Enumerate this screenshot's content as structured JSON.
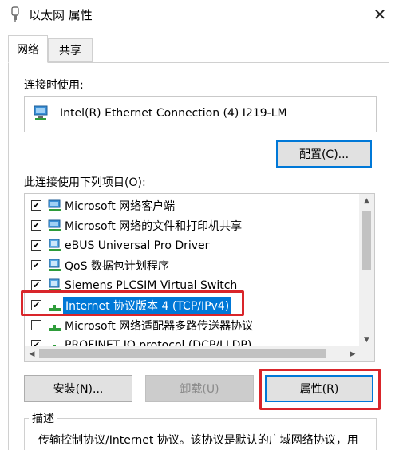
{
  "window": {
    "title": "以太网 属性",
    "close_glyph": "✕"
  },
  "tabs": [
    {
      "label": "网络",
      "active": true
    },
    {
      "label": "共享",
      "active": false
    }
  ],
  "connect_using_label": "连接时使用:",
  "adapter_name": "Intel(R) Ethernet Connection (4) I219-LM",
  "configure_button": "配置(C)...",
  "items_label": "此连接使用下列项目(O):",
  "items": [
    {
      "label": "Microsoft 网络客户端",
      "checked": true,
      "selected": false,
      "icon": "network-client-icon"
    },
    {
      "label": "Microsoft 网络的文件和打印机共享",
      "checked": true,
      "selected": false,
      "icon": "file-printer-sharing-icon"
    },
    {
      "label": "eBUS Universal Pro Driver",
      "checked": true,
      "selected": false,
      "icon": "service-icon"
    },
    {
      "label": "QoS 数据包计划程序",
      "checked": true,
      "selected": false,
      "icon": "service-icon"
    },
    {
      "label": "Siemens PLCSIM Virtual Switch",
      "checked": true,
      "selected": false,
      "icon": "service-icon"
    },
    {
      "label": "Internet 协议版本 4 (TCP/IPv4)",
      "checked": true,
      "selected": true,
      "icon": "protocol-icon"
    },
    {
      "label": "Microsoft 网络适配器多路传送器协议",
      "checked": false,
      "selected": false,
      "icon": "protocol-icon"
    },
    {
      "label": "PROFINET IO protocol (DCP/LLDP)",
      "checked": true,
      "selected": false,
      "icon": "protocol-icon"
    }
  ],
  "buttons": {
    "install": "安装(N)...",
    "uninstall": "卸载(U)",
    "properties": "属性(R)"
  },
  "description": {
    "legend": "描述",
    "text": "传输控制协议/Internet 协议。该协议是默认的广域网络协议，用"
  },
  "colors": {
    "selection": "#0078d7",
    "annotation_red": "#d9252a"
  }
}
